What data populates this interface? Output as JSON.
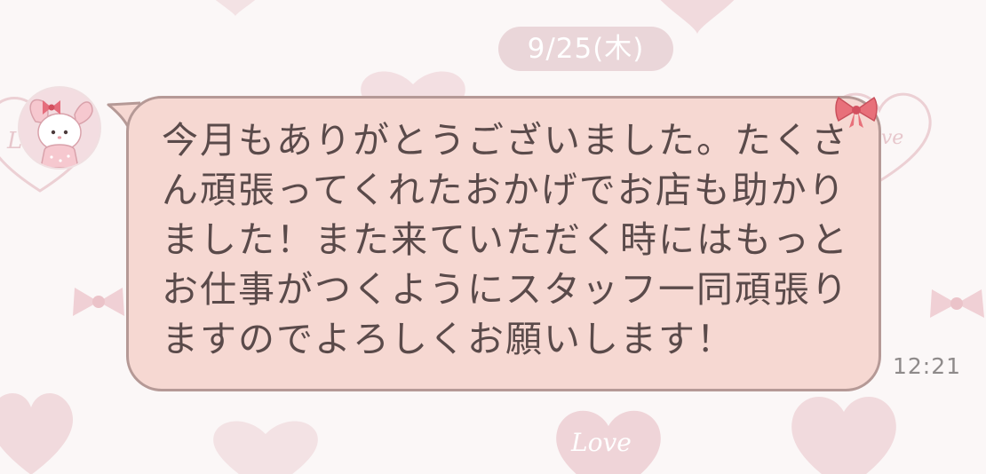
{
  "chat": {
    "date_label": "9/25(木)",
    "message_text": "今月もありがとうございました。たくさん頑張ってくれたおかげでお店も助かりました！また来ていただく時にはもっとお仕事がつくようにスタッフ一同頑張りますのでよろしくお願いします！",
    "timestamp": "12:21",
    "avatar_icon": "rabbit-character-icon"
  },
  "background": {
    "heart_words": [
      "Love",
      "Love",
      "Love"
    ]
  },
  "colors": {
    "background": "#fbf7f7",
    "bubble_fill": "#f6d8d2",
    "bubble_border": "#b59996",
    "text": "#5a4a4a",
    "date_pill": "#e8d3d6",
    "heart": "#f1dadd",
    "bow": "#e8707a"
  }
}
